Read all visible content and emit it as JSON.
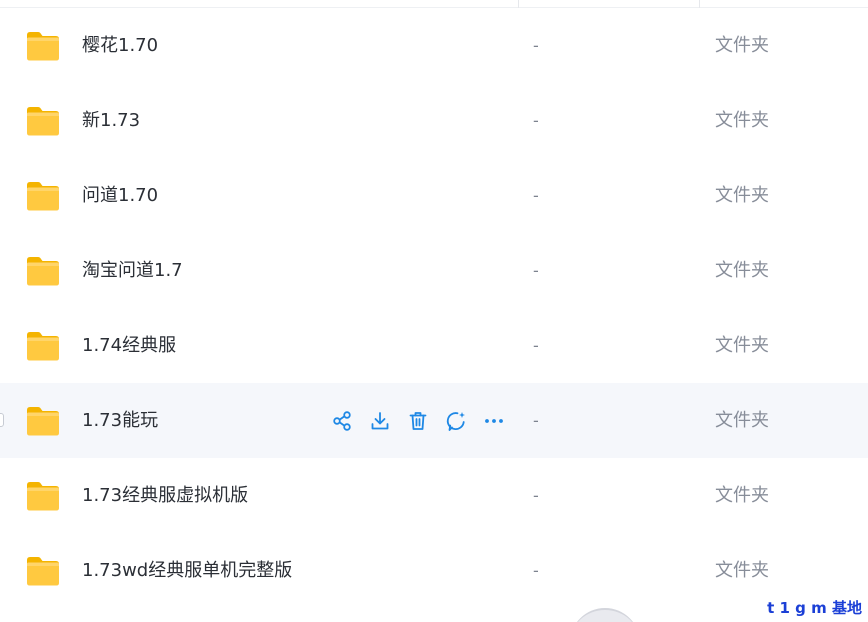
{
  "files": [
    {
      "name": "樱花1.70",
      "size": "-",
      "type": "文件夹"
    },
    {
      "name": "新1.73",
      "size": "-",
      "type": "文件夹"
    },
    {
      "name": "问道1.70",
      "size": "-",
      "type": "文件夹"
    },
    {
      "name": "淘宝问道1.7",
      "size": "-",
      "type": "文件夹"
    },
    {
      "name": "1.74经典服",
      "size": "-",
      "type": "文件夹"
    },
    {
      "name": "1.73能玩",
      "size": "-",
      "type": "文件夹",
      "hovered": true
    },
    {
      "name": "1.73经典服虚拟机版",
      "size": "-",
      "type": "文件夹"
    },
    {
      "name": "1.73wd经典服单机完整版",
      "size": "-",
      "type": "文件夹"
    }
  ],
  "row_actions": [
    {
      "icon": "share-icon"
    },
    {
      "icon": "download-icon"
    },
    {
      "icon": "delete-icon"
    },
    {
      "icon": "ai-chat-icon"
    },
    {
      "icon": "more-icon"
    }
  ],
  "watermark": "t 1 g m 基地",
  "colors": {
    "accent": "#1e88e5",
    "folder": "#ffc533",
    "hover_row": "#f5f7fb",
    "watermark": "#1b3fd6"
  }
}
